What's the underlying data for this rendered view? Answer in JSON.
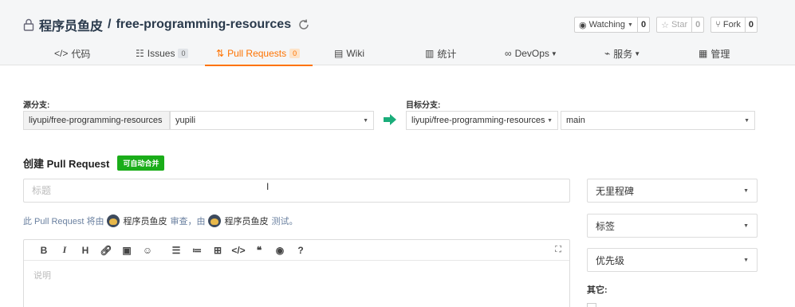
{
  "repo": {
    "owner": "程序员鱼皮",
    "separator": "/",
    "name": "free-programming-resources"
  },
  "actions": {
    "watch_label": "Watching",
    "watch_count": "0",
    "star_label": "Star",
    "star_count": "0",
    "fork_label": "Fork",
    "fork_count": "0"
  },
  "tabs": {
    "code": "代码",
    "issues": "Issues",
    "issues_count": "0",
    "pull_requests": "Pull Requests",
    "pull_requests_count": "0",
    "wiki": "Wiki",
    "stats": "统计",
    "devops": "DevOps",
    "services": "服务",
    "manage": "管理"
  },
  "branches": {
    "source_label": "源分支:",
    "source_repo": "liyupi/free-programming-resources",
    "source_branch": "yupili",
    "target_label": "目标分支:",
    "target_repo": "liyupi/free-programming-resources",
    "target_branch": "main"
  },
  "create": {
    "heading": "创建 Pull Request",
    "auto_merge": "可自动合并",
    "title_placeholder": "标题",
    "review_prefix": "此 Pull Request 将由",
    "reviewer": "程序员鱼皮",
    "review_mid": "审查，由",
    "tester": "程序员鱼皮",
    "review_suffix": "测试。",
    "desc_placeholder": "说明"
  },
  "toolbar": {
    "bold": "B",
    "italic": "I",
    "heading": "H"
  },
  "sidebar": {
    "milestone": "无里程碑",
    "labels": "标签",
    "priority": "优先级",
    "other": "其它:"
  }
}
